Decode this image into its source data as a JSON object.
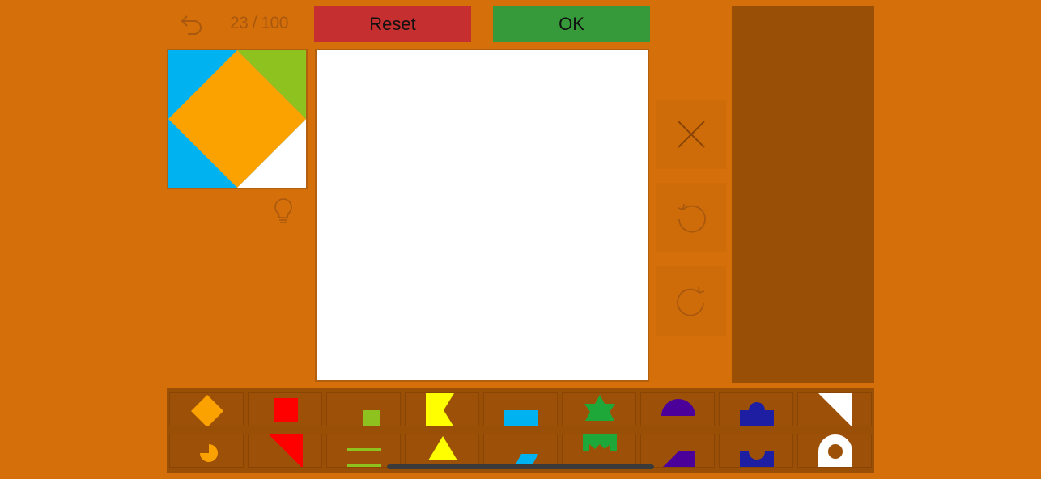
{
  "header": {
    "level_counter": "23 / 100",
    "reset_label": "Reset",
    "ok_label": "OK"
  },
  "colors": {
    "background": "#d46f0a",
    "reset": "#c62f2f",
    "ok": "#36993a",
    "panel": "#9a4f06",
    "orange": "#fba100",
    "blue": "#00b3f0",
    "green": "#8dc21f",
    "red": "#ff0000",
    "yellow": "#ffff00",
    "darkgreen": "#1fa83a",
    "purple": "#4b0099",
    "navy": "#1e1ea3",
    "white": "#ffffff"
  },
  "icons": {
    "back": "undo-arrow-icon",
    "hint": "lightbulb-icon",
    "delete": "close-x-icon",
    "rotate_left": "rotate-counterclockwise-icon",
    "rotate_right": "rotate-clockwise-icon"
  },
  "tray": {
    "row1": [
      "orange-diamond",
      "red-square",
      "green-small-square",
      "yellow-notched-rectangle",
      "blue-rectangle",
      "green-star",
      "purple-semicircle",
      "navy-bump-block",
      "white-right-triangle"
    ],
    "row2": [
      "orange-pie-circle",
      "red-triangle",
      "green-lines",
      "yellow-triangle",
      "blue-parallelogram",
      "green-notched-frame",
      "purple-trapezoid",
      "navy-notched-block",
      "white-rounded-ring"
    ]
  }
}
